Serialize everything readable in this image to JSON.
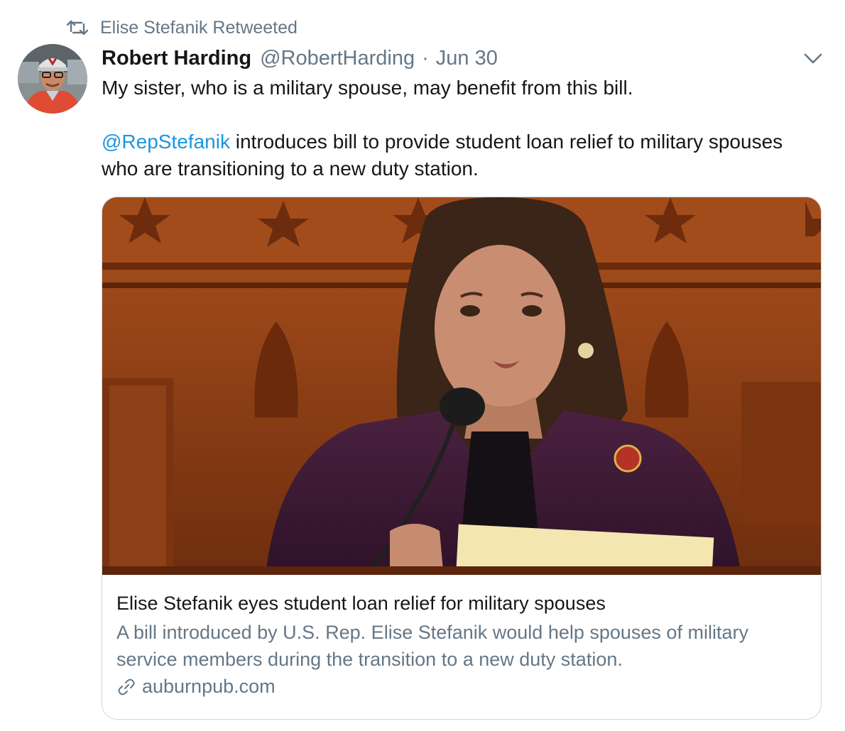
{
  "retweet": {
    "icon": "retweet-icon",
    "label": "Elise Stefanik Retweeted"
  },
  "tweet": {
    "author_name": "Robert Harding",
    "author_handle": "@RobertHarding",
    "separator": "·",
    "date": "Jun 30",
    "text_line1": "My sister, who is a military spouse, may benefit from this bill.",
    "mention": "@RepStefanik",
    "text_line2_rest": " introduces bill to provide student loan relief to military spouses who are transitioning to a new duty station.",
    "menu_icon": "chevron-down-icon"
  },
  "card": {
    "title": "Elise Stefanik eyes student loan relief for military spouses",
    "description": "A bill introduced by U.S. Rep. Elise Stefanik would help spouses of military service members during the transition to a new duty station.",
    "link_icon": "link-icon",
    "domain": "auburnpub.com"
  },
  "colors": {
    "link_blue": "#1b95e0",
    "secondary_gray": "#657786",
    "border": "#ccd6dd",
    "text": "#14171a"
  }
}
